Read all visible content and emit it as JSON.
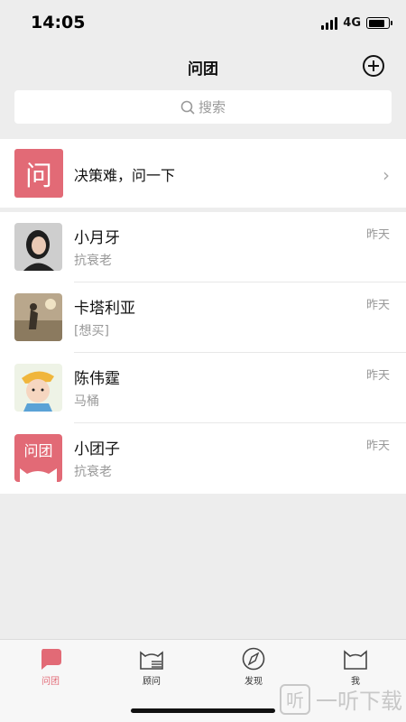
{
  "status": {
    "time": "14:05",
    "network": "4G",
    "battery_level": 0.85
  },
  "nav": {
    "title": "问团"
  },
  "search": {
    "placeholder": "搜索"
  },
  "banner": {
    "icon_text": "问",
    "text": "决策难，问一下"
  },
  "conversations": [
    {
      "name": "小月牙",
      "preview": "抗衰老",
      "time": "昨天",
      "avatar": "photo-woman"
    },
    {
      "name": "卡塔利亚",
      "preview": "[想买]",
      "time": "昨天",
      "avatar": "photo-field"
    },
    {
      "name": "陈伟霆",
      "preview": "马桶",
      "time": "昨天",
      "avatar": "cartoon-boy"
    },
    {
      "name": "小团子",
      "preview": "抗衰老",
      "time": "昨天",
      "avatar": "logo-wentuan",
      "avatar_text": "问团"
    }
  ],
  "tabs": [
    {
      "label": "问团",
      "icon": "chat-bubble-icon",
      "active": true
    },
    {
      "label": "顾问",
      "icon": "cat-menu-icon",
      "active": false
    },
    {
      "label": "发现",
      "icon": "compass-icon",
      "active": false
    },
    {
      "label": "我",
      "icon": "cat-face-icon",
      "active": false
    }
  ],
  "watermark": {
    "icon_text": "听",
    "text": "一听下载"
  },
  "colors": {
    "accent": "#e26a76",
    "background": "#ededed"
  }
}
